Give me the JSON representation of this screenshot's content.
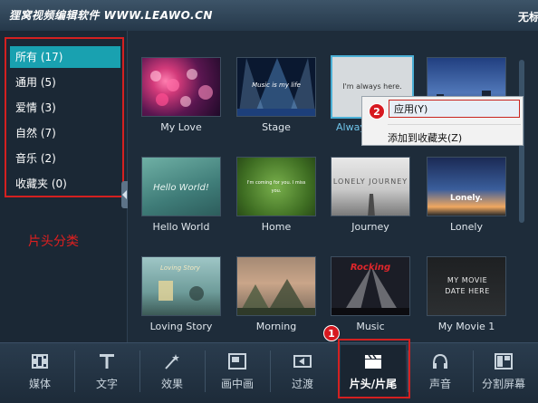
{
  "window": {
    "app_title": "狸窝视频编辑软件 WWW.LEAWO.CN",
    "project_title_partial": "无标"
  },
  "sidebar": {
    "categories": [
      {
        "label": "所有 (17)",
        "active": true
      },
      {
        "label": "通用 (5)",
        "active": false
      },
      {
        "label": "爱情 (3)",
        "active": false
      },
      {
        "label": "自然 (7)",
        "active": false
      },
      {
        "label": "音乐 (2)",
        "active": false
      },
      {
        "label": "收藏夹 (0)",
        "active": false
      }
    ],
    "annotation": "片头分类"
  },
  "templates": [
    {
      "name": "My Love"
    },
    {
      "name": "Stage",
      "overlay_text": "Music is my life"
    },
    {
      "name": "Always",
      "overlay_text": "I'm always here.",
      "selected": true
    },
    {
      "name": ""
    },
    {
      "name": "Hello World",
      "overlay_text": "Hello World!"
    },
    {
      "name": "Home",
      "overlay_text": "I'm coming for you. I miss you."
    },
    {
      "name": "Journey",
      "overlay_text": "LONELY JOURNEY"
    },
    {
      "name": "Lonely",
      "overlay_text": "Lonely."
    },
    {
      "name": "Loving Story",
      "overlay_text": "Loving Story"
    },
    {
      "name": "Morning"
    },
    {
      "name": "Music",
      "overlay_text": "Rocking"
    },
    {
      "name": "My Movie 1",
      "overlay_text": "MY MOVIE DATE HERE"
    }
  ],
  "context_menu": {
    "items": [
      {
        "label": "应用(Y)",
        "highlighted": true
      },
      {
        "label": "添加到收藏夹(Z)",
        "highlighted": false
      }
    ]
  },
  "badges": {
    "step1": "1",
    "step2": "2"
  },
  "toolbar": {
    "tools": [
      {
        "label": "媒体",
        "icon": "film-icon"
      },
      {
        "label": "文字",
        "icon": "text-t-icon"
      },
      {
        "label": "效果",
        "icon": "magic-wand-icon"
      },
      {
        "label": "画中画",
        "icon": "picture-in-picture-icon"
      },
      {
        "label": "过渡",
        "icon": "transition-icon"
      },
      {
        "label": "片头/片尾",
        "icon": "clapperboard-icon",
        "active": true
      },
      {
        "label": "声音",
        "icon": "headphones-icon"
      },
      {
        "label": "分割屏幕",
        "icon": "split-screen-icon"
      }
    ]
  },
  "colors": {
    "accent": "#19a1b0",
    "annotation_red": "#d42020",
    "background": "#1e2c3a"
  }
}
